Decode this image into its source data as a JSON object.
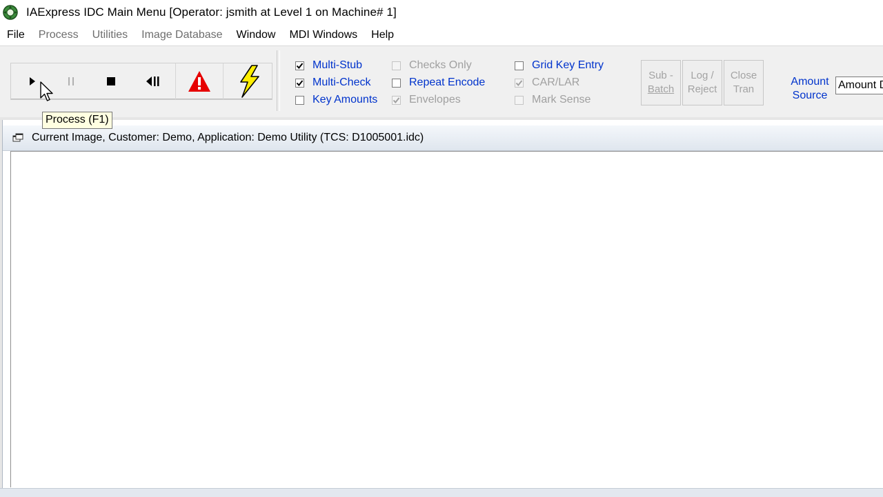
{
  "window": {
    "title": "IAExpress IDC Main Menu [Operator: jsmith at Level 1 on Machine# 1]"
  },
  "menu": {
    "items": [
      {
        "label": "File",
        "enabled": true
      },
      {
        "label": "Process",
        "enabled": false
      },
      {
        "label": "Utilities",
        "enabled": false
      },
      {
        "label": "Image Database",
        "enabled": false
      },
      {
        "label": "Window",
        "enabled": true
      },
      {
        "label": "MDI Windows",
        "enabled": true
      },
      {
        "label": "Help",
        "enabled": true
      }
    ]
  },
  "toolbar": {
    "buttons": [
      {
        "icon": "play-icon",
        "tooltip": "Process (F1)"
      },
      {
        "icon": "pause-icon"
      },
      {
        "icon": "stop-icon"
      },
      {
        "icon": "rewind-icon"
      },
      {
        "icon": "warning-icon"
      },
      {
        "icon": "lightning-icon"
      }
    ],
    "tooltip": "Process (F1)",
    "options_col1": [
      {
        "label": "Multi-Stub",
        "checked": true,
        "enabled": true
      },
      {
        "label": "Multi-Check",
        "checked": true,
        "enabled": true
      },
      {
        "label": "Key Amounts",
        "checked": false,
        "enabled": true
      }
    ],
    "options_col2": [
      {
        "label": "Checks Only",
        "checked": false,
        "enabled": false
      },
      {
        "label": "Repeat Encode",
        "checked": false,
        "enabled": true
      },
      {
        "label": "Envelopes",
        "checked": true,
        "enabled": false
      }
    ],
    "options_col3": [
      {
        "label": "Grid Key Entry",
        "checked": false,
        "enabled": true
      },
      {
        "label": "CAR/LAR",
        "checked": true,
        "enabled": false
      },
      {
        "label": "Mark Sense",
        "checked": false,
        "enabled": false
      }
    ],
    "action_buttons": {
      "sub_batch": {
        "line1": "Sub -",
        "line2": "Batch"
      },
      "log_reject": {
        "line1": "Log /",
        "line2": "Reject"
      },
      "close_tran": {
        "line1": "Close",
        "line2": "Tran"
      }
    },
    "amount_source": {
      "label_line1": "Amount",
      "label_line2": "Source",
      "value": "Amount D"
    }
  },
  "child_window": {
    "title": "Current Image, Customer: Demo, Application: Demo Utility (TCS: D1005001.idc)"
  },
  "colors": {
    "option_label": "#0033cc",
    "disabled_text": "#a0a0a0",
    "tooltip_bg": "#ffffe1",
    "warning_red": "#e60000",
    "lightning_yellow": "#ffee00"
  }
}
